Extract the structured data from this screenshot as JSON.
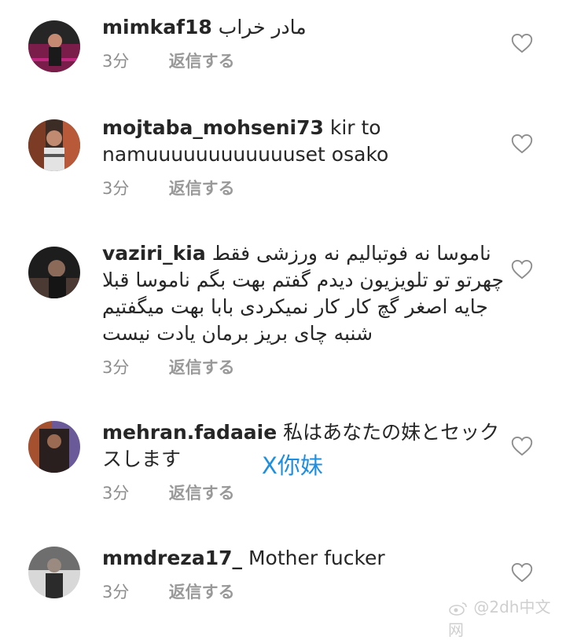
{
  "comments": [
    {
      "username": "mimkaf18",
      "text": "مادر خراب",
      "time": "3分",
      "reply_label": "返信する",
      "avatar_colors": [
        "#2a2a2a",
        "#c0277f",
        "#7a1d4a"
      ]
    },
    {
      "username": "mojtaba_mohseni73",
      "text": "kir to namuuuuuuuuuuuuset osako",
      "time": "3分",
      "reply_label": "返信する",
      "avatar_colors": [
        "#3b2c25",
        "#b85a3a",
        "#cfcfcf"
      ]
    },
    {
      "username": "vaziri_kia",
      "text": "ناموسا نه فوتبالیم نه ورزشی فقط چهرتو تو تلویزیون دیدم گفتم بهت بگم ناموسا قبلا جایه اصغر گچ کار کار نمیکردی بابا بهت میگفتیم شنبه چای بریز برمان یادت نیست",
      "time": "3分",
      "reply_label": "返信する",
      "avatar_colors": [
        "#1d1d1d",
        "#8b6a5a",
        "#4a3a33"
      ]
    },
    {
      "username": "mehran.fadaaie",
      "text": "私はあなたの妹とセックスします",
      "time": "3分",
      "reply_label": "返信する",
      "avatar_colors": [
        "#2a1f1f",
        "#a5502e",
        "#6a5a9a"
      ]
    },
    {
      "username": "mmdreza17_",
      "text": "Mother fucker",
      "time": "3分",
      "reply_label": "返信する",
      "avatar_colors": [
        "#2b2b2b",
        "#6e6e6e",
        "#d8d8d8"
      ]
    }
  ],
  "annotation": "X你妹",
  "watermark": "@2dh中文网",
  "colors": {
    "text": "#262626",
    "meta": "#8e8e8e",
    "annotation": "#1e8fe0",
    "watermark": "#cfcfcf"
  }
}
